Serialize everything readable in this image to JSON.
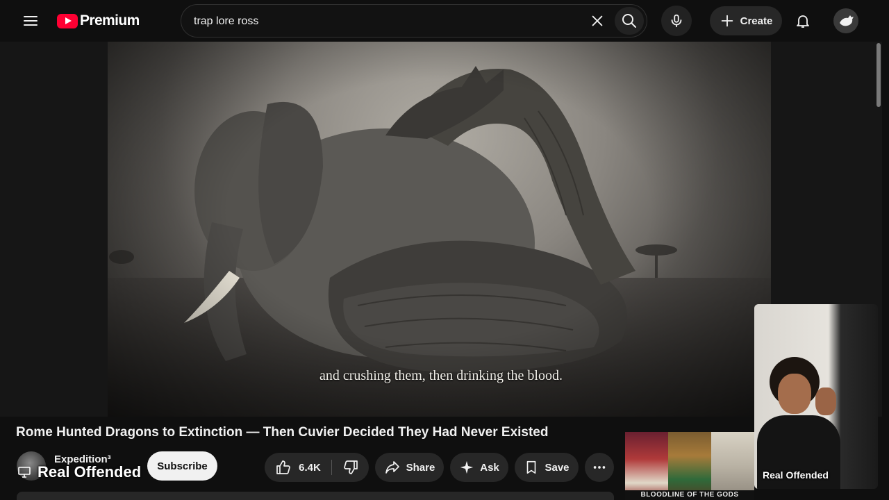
{
  "header": {
    "logo_text": "Premium",
    "search": {
      "value": "trap lore ross",
      "placeholder": "Search"
    },
    "create_label": "Create"
  },
  "player": {
    "caption": "and crushing them, then drinking the blood."
  },
  "video": {
    "title": "Rome Hunted Dragons to Extinction — Then Cuvier Decided They Had Never Existed",
    "channel_name": "Expedition³",
    "subscribe_label": "Subscribe",
    "overlay_label": "Real Offended",
    "likes": "6.4K",
    "share_label": "Share",
    "ask_label": "Ask",
    "save_label": "Save"
  },
  "related": {
    "caption": "BLOODLINE OF THE GODS"
  },
  "webcam": {
    "label": "Real Offended"
  },
  "colors": {
    "background": "#0f0f0f",
    "brand_red": "#ff0033",
    "pill": "#272727",
    "text": "#f1f1f1"
  },
  "icons": [
    "menu-icon",
    "youtube-logo-icon",
    "close-icon",
    "search-icon",
    "mic-icon",
    "plus-icon",
    "bell-icon",
    "account-icon",
    "like-icon",
    "dislike-icon",
    "share-icon",
    "sparkle-icon",
    "bookmark-icon",
    "more-icon",
    "cast-icon"
  ]
}
